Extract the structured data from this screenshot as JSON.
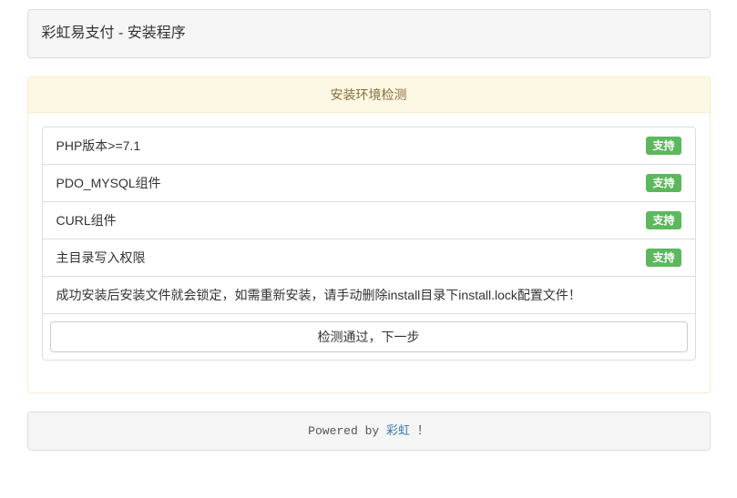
{
  "page": {
    "title": "彩虹易支付 - 安装程序"
  },
  "panel": {
    "heading": "安装环境检测",
    "checks": [
      {
        "label": "PHP版本>=7.1",
        "status": "支持"
      },
      {
        "label": "PDO_MYSQL组件",
        "status": "支持"
      },
      {
        "label": "CURL组件",
        "status": "支持"
      },
      {
        "label": "主目录写入权限",
        "status": "支持"
      }
    ],
    "notice": "成功安装后安装文件就会锁定，如需重新安装，请手动删除install目录下install.lock配置文件！",
    "next_button": "检测通过，下一步"
  },
  "footer": {
    "prefix": "Powered by ",
    "link": "彩虹",
    "suffix": " ！"
  },
  "colors": {
    "badge_success": "#5cb85c",
    "panel_warning_bg": "#fcf8e3",
    "panel_warning_border": "#faebcc",
    "panel_warning_text": "#8a6d3b",
    "panel_gray_bg": "#f5f5f5",
    "link_blue": "#337ab7"
  }
}
